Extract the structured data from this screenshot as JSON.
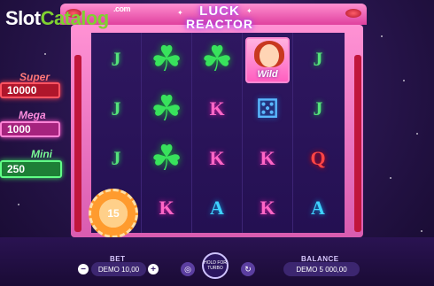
{
  "watermark": {
    "part1": "Slot",
    "part2": "Catalog",
    "suffix": ".com"
  },
  "game": {
    "title_line1": "LUCK",
    "title_line2": "REACTOR"
  },
  "jackpots": {
    "super": {
      "label": "Super",
      "value": "10000"
    },
    "mega": {
      "label": "Mega",
      "value": "1000"
    },
    "mini": {
      "label": "Mini",
      "value": "250"
    }
  },
  "reels": [
    [
      "J",
      "clover",
      "clover",
      "wild"
    ],
    [
      "J",
      "clover",
      "K",
      "dice"
    ],
    [
      "J",
      "clover",
      "K",
      "K"
    ],
    [
      "K",
      "A",
      "K",
      "A"
    ]
  ],
  "reel5": [
    "J",
    "J",
    "Q",
    "A"
  ],
  "wild_label": "Wild",
  "chip_value": "15",
  "controls": {
    "bet_label": "BET",
    "bet_value": "DEMO 10,00",
    "balance_label": "BALANCE",
    "balance_value": "DEMO 5 000,00",
    "hold_label": "HOLD FOR TURBO",
    "minus": "−",
    "plus": "+"
  },
  "icons": {
    "coins": "coins-icon",
    "hold": "spin-icon",
    "refresh": "refresh-icon"
  }
}
